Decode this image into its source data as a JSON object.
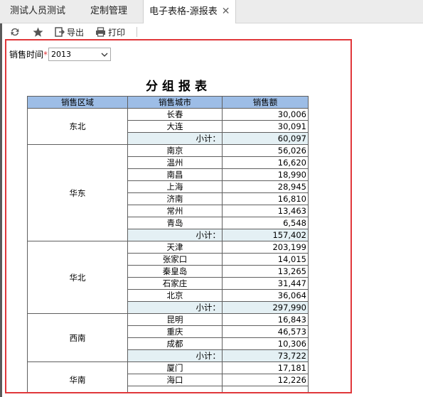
{
  "tabs": [
    {
      "label": "测试人员测试"
    },
    {
      "label": "定制管理"
    },
    {
      "label": "电子表格-源报表",
      "close": "✕"
    }
  ],
  "toolbar": {
    "refresh_icon": "refresh-icon",
    "favorite_icon": "star-icon",
    "export_label": "导出",
    "print_label": "打印"
  },
  "params": {
    "label": "销售时间",
    "required_mark": "*",
    "value": "2013"
  },
  "report": {
    "title": "分组报表",
    "headers": [
      "销售区域",
      "销售城市",
      "销售额"
    ],
    "subtotal_label": "小计：",
    "groups": [
      {
        "region": "东北",
        "rows": [
          [
            "长春",
            "30,006"
          ],
          [
            "大连",
            "30,091"
          ]
        ],
        "subtotal": "60,097"
      },
      {
        "region": "华东",
        "rows": [
          [
            "南京",
            "56,026"
          ],
          [
            "温州",
            "16,620"
          ],
          [
            "南昌",
            "18,990"
          ],
          [
            "上海",
            "28,945"
          ],
          [
            "济南",
            "16,810"
          ],
          [
            "常州",
            "13,463"
          ],
          [
            "青岛",
            "6,548"
          ]
        ],
        "subtotal": "157,402"
      },
      {
        "region": "华北",
        "rows": [
          [
            "天津",
            "203,199"
          ],
          [
            "张家口",
            "14,015"
          ],
          [
            "秦皇岛",
            "13,265"
          ],
          [
            "石家庄",
            "31,447"
          ],
          [
            "北京",
            "36,064"
          ]
        ],
        "subtotal": "297,990"
      },
      {
        "region": "西南",
        "rows": [
          [
            "昆明",
            "16,843"
          ],
          [
            "重庆",
            "46,573"
          ],
          [
            "成都",
            "10,306"
          ]
        ],
        "subtotal": "73,722"
      },
      {
        "region": "华南",
        "rows": [
          [
            "厦门",
            "17,181"
          ],
          [
            "海口",
            "12,226"
          ],
          [
            "",
            ""
          ]
        ],
        "subtotal": null
      }
    ]
  },
  "colors": {
    "header_bg": "#9dbde6",
    "subtotal_bg": "#e4f0f4",
    "highlight_border": "#e0373a"
  }
}
